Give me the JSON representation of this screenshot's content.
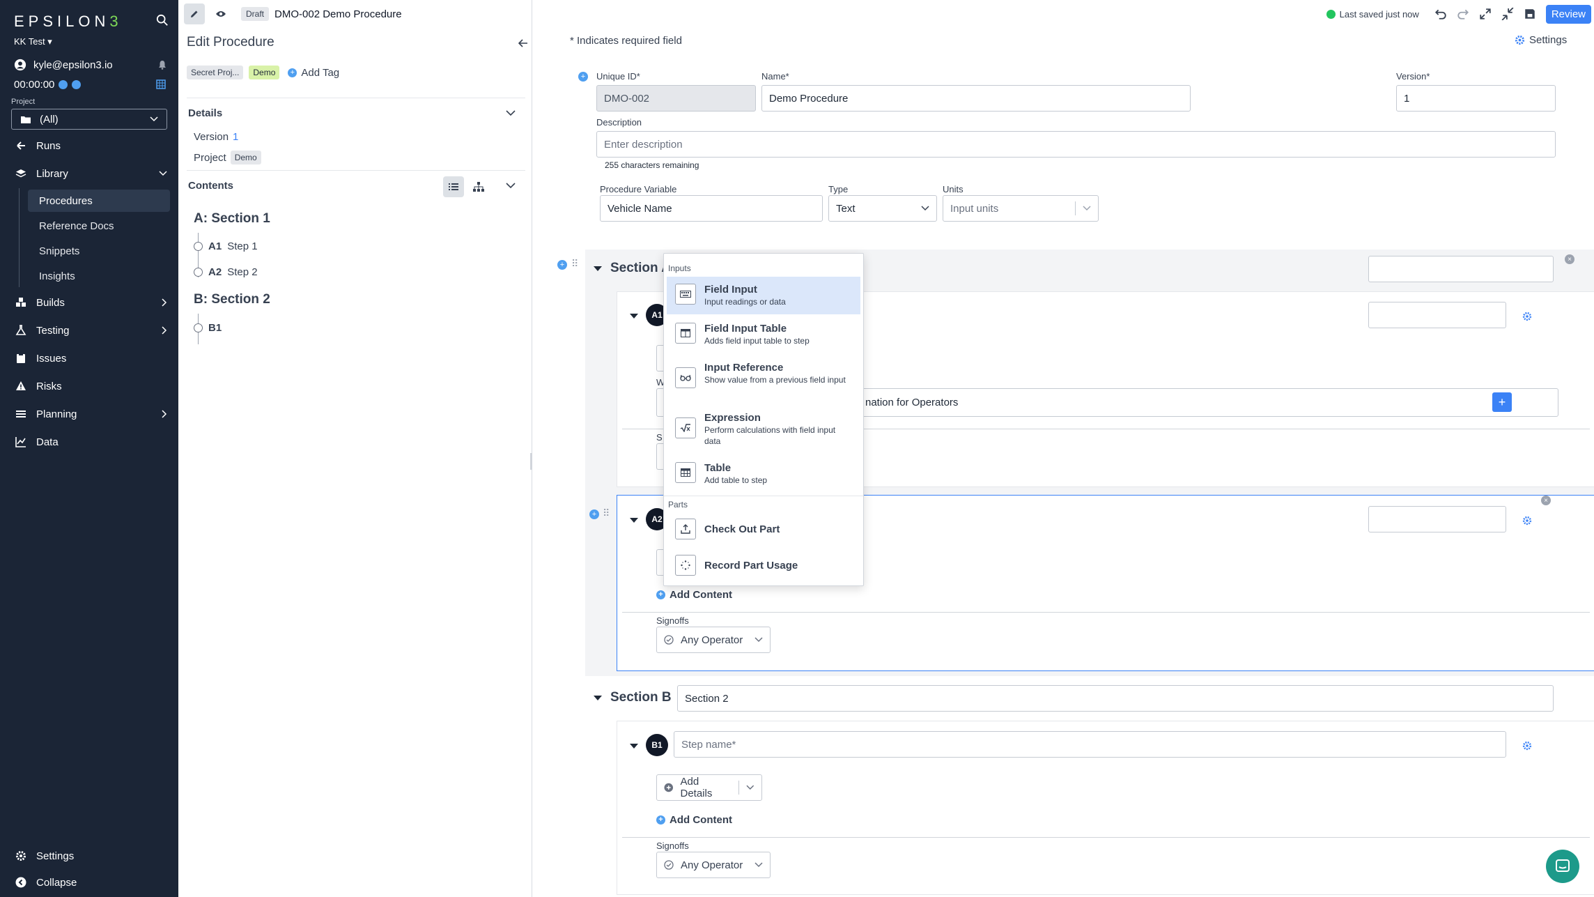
{
  "nav": {
    "logo": "EPSILON",
    "logo_tail": "3",
    "workspace": "KK Test",
    "user": "kyle@epsilon3.io",
    "timer": "00:00:00",
    "project_label": "Project",
    "project_value": "(All)",
    "items": {
      "runs": "Runs",
      "library": "Library",
      "builds": "Builds",
      "testing": "Testing",
      "issues": "Issues",
      "risks": "Risks",
      "planning": "Planning",
      "data": "Data",
      "settings": "Settings",
      "collapse": "Collapse"
    },
    "library_sub": {
      "procedures": "Procedures",
      "reference_docs": "Reference Docs",
      "snippets": "Snippets",
      "insights": "Insights"
    }
  },
  "side": {
    "status": "Draft",
    "procedure_title": "DMO-002 Demo Procedure",
    "heading": "Edit Procedure",
    "tags": [
      "Secret Proj...",
      "Demo"
    ],
    "add_tag": "Add Tag",
    "details_heading": "Details",
    "version_label": "Version",
    "version_value": "1",
    "project_label": "Project",
    "project_value": "Demo",
    "contents_heading": "Contents",
    "outline": {
      "section_a": "A: Section 1",
      "a1_id": "A1",
      "a1_name": "Step 1",
      "a2_id": "A2",
      "a2_name": "Step 2",
      "section_b": "B: Section 2",
      "b1_id": "B1"
    }
  },
  "topbar": {
    "saved": "Last saved just now",
    "review": "Review"
  },
  "form": {
    "required_note": "* Indicates required field",
    "settings": "Settings",
    "unique_id_label": "Unique ID*",
    "unique_id": "DMO-002",
    "name_label": "Name*",
    "name": "Demo Procedure",
    "version_label": "Version*",
    "version": "1",
    "description_label": "Description",
    "description_placeholder": "Enter description",
    "chars_remaining": "255 characters remaining",
    "proc_var_label": "Procedure Variable",
    "proc_var": "Vehicle Name",
    "type_label": "Type",
    "type": "Text",
    "units_label": "Units",
    "units_placeholder": "Input units"
  },
  "sections": {
    "a_title": "Section A",
    "b_title": "Section B",
    "b_name": "Section 2",
    "a1_badge": "A1",
    "a1_content_tail": "nation for Operators",
    "a1_partial_w": "W",
    "a1_partial_s": "S",
    "a2_badge": "A2",
    "b1_badge": "B1",
    "b1_placeholder": "Step name*",
    "add_details": "Add Details",
    "add_content": "Add Content",
    "signoffs": "Signoffs",
    "any_operator": "Any Operator"
  },
  "menu": {
    "inputs_group": "Inputs",
    "parts_group": "Parts",
    "items": [
      {
        "title": "Field Input",
        "desc": "Input readings or data",
        "icon": "keyboard-icon"
      },
      {
        "title": "Field Input Table",
        "desc": "Adds field input table to step",
        "icon": "table-columns-icon"
      },
      {
        "title": "Input Reference",
        "desc": "Show value from a previous field input",
        "icon": "glasses-icon"
      },
      {
        "title": "Expression",
        "desc": "Perform calculations with field input data",
        "icon": "square-root-icon"
      },
      {
        "title": "Table",
        "desc": "Add table to step",
        "icon": "table-icon"
      }
    ],
    "parts": [
      {
        "title": "Check Out Part",
        "icon": "upload-tray-icon"
      },
      {
        "title": "Record Part Usage",
        "icon": "spinner-icon"
      }
    ]
  },
  "colors": {
    "nav_bg": "#1b2536",
    "accent": "#3b82f6",
    "logo_accent": "#7ed957",
    "tag_green": "#d9f2a8",
    "chat": "#1d9a8a"
  }
}
